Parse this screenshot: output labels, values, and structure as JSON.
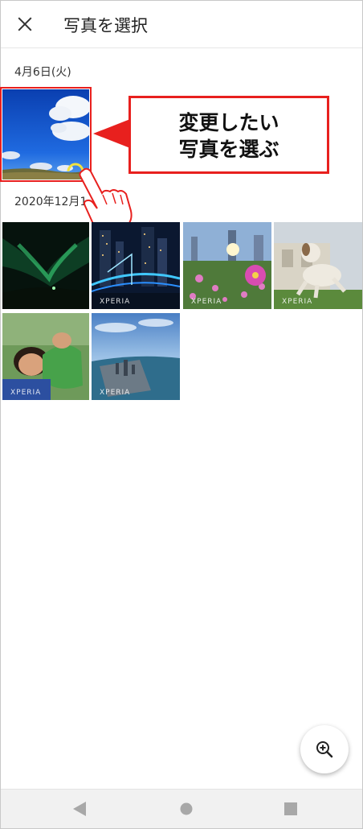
{
  "header": {
    "title": "写真を選択",
    "close_icon": "close-icon"
  },
  "sections": [
    {
      "date": "4月6日(火)"
    },
    {
      "date": "2020年12月1"
    }
  ],
  "photos": [
    {
      "name": "blue-sky-field",
      "watermark": ""
    },
    {
      "name": "aurora",
      "watermark": ""
    },
    {
      "name": "city-night-bridge",
      "watermark": "XPERIA"
    },
    {
      "name": "cosmos-flowers",
      "watermark": "XPERIA"
    },
    {
      "name": "dog-jumping",
      "watermark": "XPERIA"
    },
    {
      "name": "children-hugging",
      "watermark": "XPERIA"
    },
    {
      "name": "city-aerial",
      "watermark": "XPERIA"
    }
  ],
  "callout": {
    "text": "変更したい\n写真を選ぶ"
  },
  "fab": {
    "icon": "zoom-in-icon"
  },
  "navigation": {
    "back_icon": "back-triangle-icon",
    "home_icon": "home-circle-icon",
    "recents_icon": "recents-square-icon"
  },
  "colors": {
    "accent_red": "#e8201e",
    "nav_icon": "#a8a8a8"
  }
}
